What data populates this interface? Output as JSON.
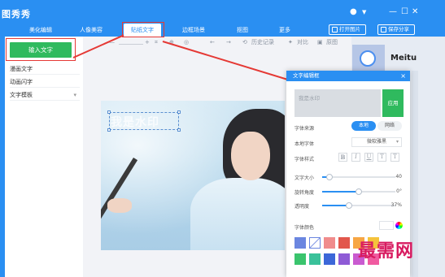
{
  "app": {
    "title": "图秀秀"
  },
  "window_controls": [
    "●",
    "▼",
    "—",
    "☐",
    "✕"
  ],
  "tabs": [
    {
      "label": "美化编辑"
    },
    {
      "label": "人像美容"
    },
    {
      "label": "贴纸文字"
    },
    {
      "label": "边框场景"
    },
    {
      "label": "抠图"
    },
    {
      "label": "更多"
    }
  ],
  "topbar_buttons": {
    "open": "打开图片",
    "save": "保存分享"
  },
  "left_panel": {
    "input_text_button": "输入文字",
    "menu": [
      "漫画文字",
      "动画闪字",
      "文字模板"
    ]
  },
  "toolbar": {
    "history": "历史记录",
    "compare": "对比",
    "original": "原图"
  },
  "canvas": {
    "watermark_text": "我是水印"
  },
  "right": {
    "brand": "Meitu"
  },
  "dialog": {
    "title": "文字编辑框",
    "placeholder": "我是水印",
    "apply": "应用",
    "source_label": "字体来源",
    "source_local": "本地",
    "source_online": "网络",
    "font_label": "本地字体",
    "font_value": "微软雅黑",
    "style_label": "字体样式",
    "style_buttons": [
      "B",
      "I",
      "U",
      "T",
      "T"
    ],
    "size_label": "文字大小",
    "size_value": "40",
    "size_fraction": 0.1,
    "rotate_label": "旋转角度",
    "rotate_value": "0°",
    "rotate_fraction": 0.5,
    "opacity_label": "透明度",
    "opacity_value": "37%",
    "opacity_fraction": 0.37,
    "color_label": "字体颜色",
    "swatches": [
      "#6b86e0",
      "#ffffff",
      "#f08c8c",
      "#e2574c",
      "#f7a644",
      "#f5c33b",
      "#3ac46d",
      "#3ac19a",
      "#3c67d8",
      "#8e5bd6",
      "#c95bd0",
      "#f05aa0"
    ]
  },
  "corner_watermark": "最需网",
  "colors": {
    "accent": "#2a8ff2",
    "green": "#2fba5e",
    "red": "#e53935"
  }
}
